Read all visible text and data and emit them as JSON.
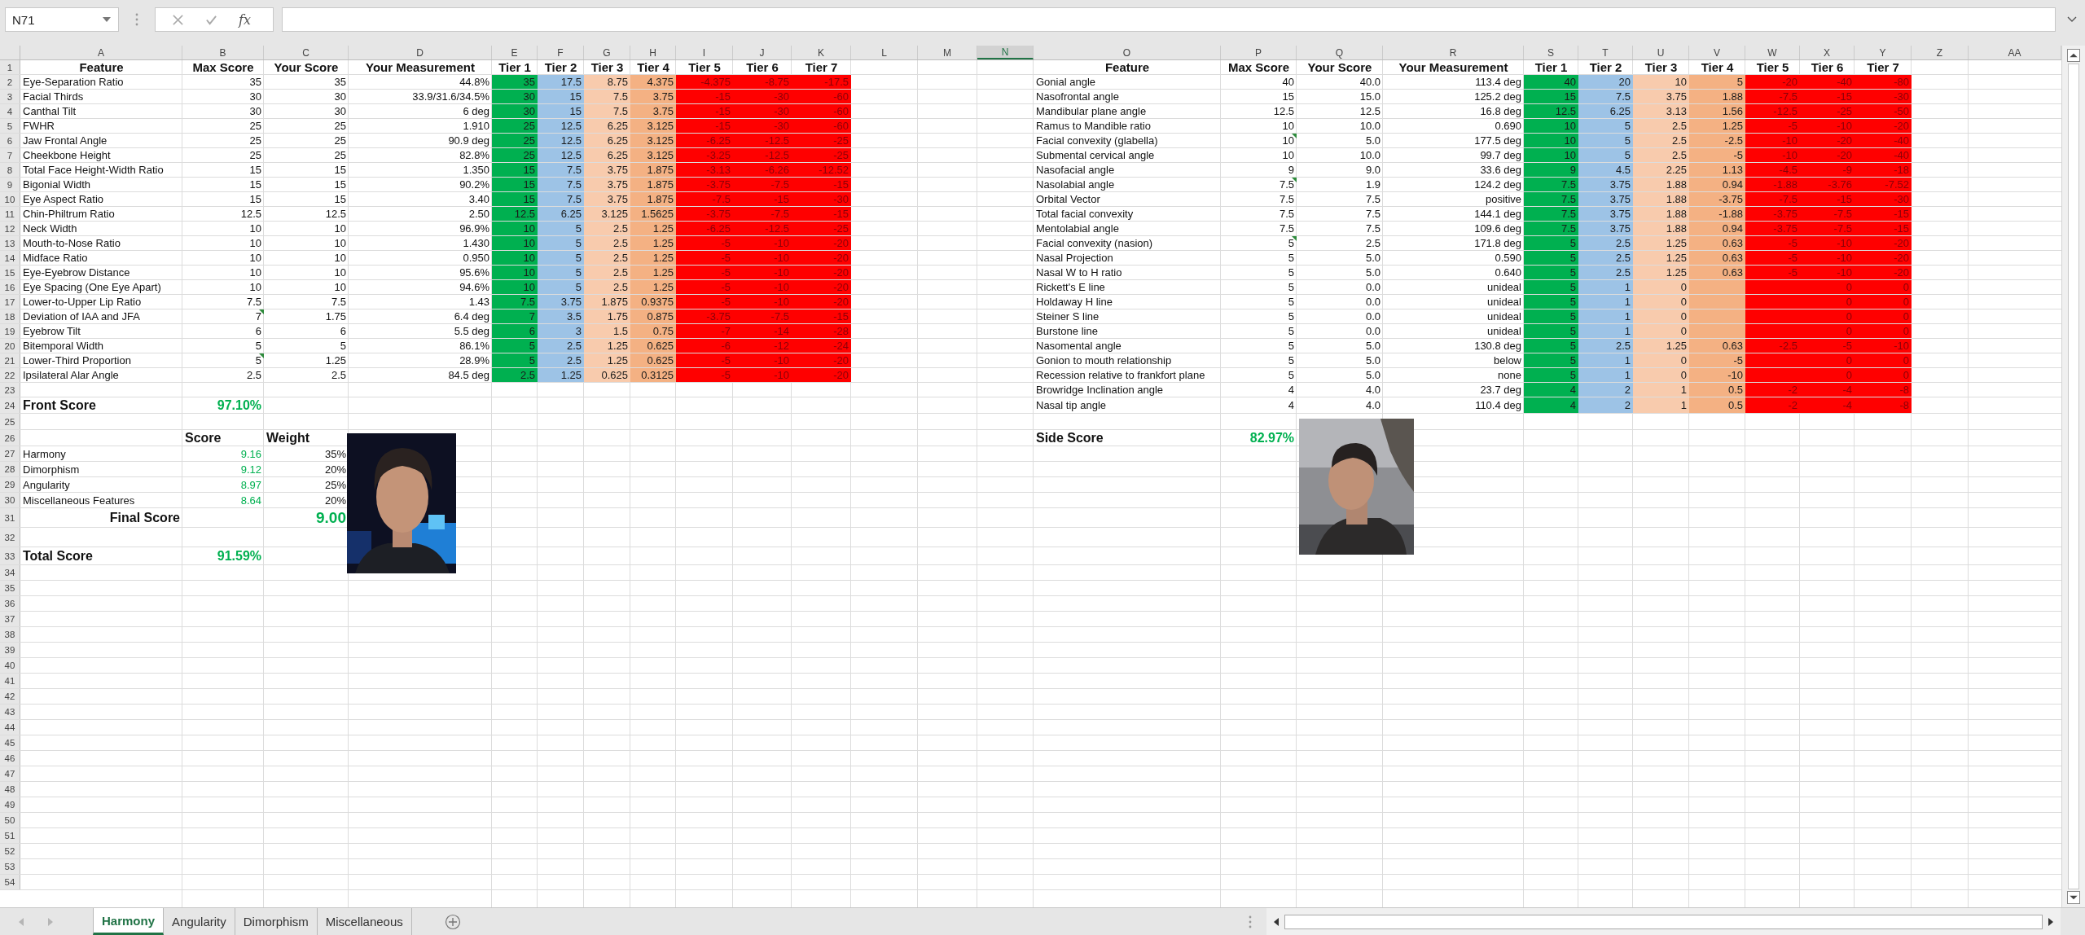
{
  "name_box": {
    "value": "N71"
  },
  "formula_bar": {
    "function_label": "fx"
  },
  "column_headers": [
    {
      "label": "A",
      "selected": false
    },
    {
      "label": "B",
      "selected": false
    },
    {
      "label": "C",
      "selected": false
    },
    {
      "label": "D",
      "selected": false
    },
    {
      "label": "E",
      "selected": false
    },
    {
      "label": "F",
      "selected": false
    },
    {
      "label": "G",
      "selected": false
    },
    {
      "label": "H",
      "selected": false
    },
    {
      "label": "I",
      "selected": false
    },
    {
      "label": "J",
      "selected": false
    },
    {
      "label": "K",
      "selected": false
    },
    {
      "label": "L",
      "selected": false
    },
    {
      "label": "M",
      "selected": false
    },
    {
      "label": "N",
      "selected": true
    },
    {
      "label": "O",
      "selected": false
    },
    {
      "label": "P",
      "selected": false
    },
    {
      "label": "Q",
      "selected": false
    },
    {
      "label": "R",
      "selected": false
    },
    {
      "label": "S",
      "selected": false
    },
    {
      "label": "T",
      "selected": false
    },
    {
      "label": "U",
      "selected": false
    },
    {
      "label": "V",
      "selected": false
    },
    {
      "label": "W",
      "selected": false
    },
    {
      "label": "X",
      "selected": false
    },
    {
      "label": "Y",
      "selected": false
    },
    {
      "label": "Z",
      "selected": false
    },
    {
      "label": "AA",
      "selected": false
    }
  ],
  "row_headers": [
    "1",
    "2",
    "3",
    "4",
    "5",
    "6",
    "7",
    "8",
    "9",
    "10",
    "11",
    "12",
    "13",
    "14",
    "15",
    "16",
    "17",
    "18",
    "19",
    "20",
    "21",
    "22",
    "23",
    "24",
    "25",
    "26",
    "27",
    "28",
    "29",
    "30",
    "31",
    "32",
    "33",
    "34",
    "35",
    "36",
    "37",
    "38",
    "39",
    "40",
    "41",
    "42",
    "43",
    "44",
    "45",
    "46",
    "47",
    "48",
    "49",
    "50",
    "51",
    "52",
    "53",
    "54"
  ],
  "front_table": {
    "columns": [
      "Feature",
      "Max Score",
      "Your Score",
      "Your Measurement"
    ],
    "tier_columns": [
      {
        "label": "Tier 1",
        "color": "#00b050"
      },
      {
        "label": "Tier 2",
        "color": "#9dc3e6"
      },
      {
        "label": "Tier 3",
        "color": "#f8cbad"
      },
      {
        "label": "Tier 4",
        "color": "#f4b183"
      },
      {
        "label": "Tier 5",
        "color": "#ff0000"
      },
      {
        "label": "Tier 6",
        "color": "#ff0000"
      },
      {
        "label": "Tier 7",
        "color": "#ff0000"
      }
    ],
    "rows": [
      {
        "feature": "Eye-Separation Ratio",
        "max_score": "35",
        "your_score": "35",
        "measurement": "44.8%",
        "tiers": {
          "tier_1": "35",
          "tier_2": "17.5",
          "tier_3": "8.75",
          "tier_4": "4.375",
          "tier_5": "-4.375",
          "tier_6": "-8.75",
          "tier_7": "-17.5"
        },
        "note": false
      },
      {
        "feature": "Facial Thirds",
        "max_score": "30",
        "your_score": "30",
        "measurement": "33.9/31.6/34.5%",
        "tiers": {
          "tier_1": "30",
          "tier_2": "15",
          "tier_3": "7.5",
          "tier_4": "3.75",
          "tier_5": "-15",
          "tier_6": "-30",
          "tier_7": "-60"
        },
        "note": false
      },
      {
        "feature": "Canthal Tilt",
        "max_score": "30",
        "your_score": "30",
        "measurement": "6 deg",
        "tiers": {
          "tier_1": "30",
          "tier_2": "15",
          "tier_3": "7.5",
          "tier_4": "3.75",
          "tier_5": "-15",
          "tier_6": "-30",
          "tier_7": "-60"
        },
        "note": false
      },
      {
        "feature": "FWHR",
        "max_score": "25",
        "your_score": "25",
        "measurement": "1.910",
        "tiers": {
          "tier_1": "25",
          "tier_2": "12.5",
          "tier_3": "6.25",
          "tier_4": "3.125",
          "tier_5": "-15",
          "tier_6": "-30",
          "tier_7": "-60"
        },
        "note": false
      },
      {
        "feature": "Jaw Frontal Angle",
        "max_score": "25",
        "your_score": "25",
        "measurement": "90.9 deg",
        "tiers": {
          "tier_1": "25",
          "tier_2": "12.5",
          "tier_3": "6.25",
          "tier_4": "3.125",
          "tier_5": "-6.25",
          "tier_6": "-12.5",
          "tier_7": "-25"
        },
        "note": false
      },
      {
        "feature": "Cheekbone Height",
        "max_score": "25",
        "your_score": "25",
        "measurement": "82.8%",
        "tiers": {
          "tier_1": "25",
          "tier_2": "12.5",
          "tier_3": "6.25",
          "tier_4": "3.125",
          "tier_5": "-3.25",
          "tier_6": "-12.5",
          "tier_7": "-25"
        },
        "note": false
      },
      {
        "feature": "Total Face Height-Width Ratio",
        "max_score": "15",
        "your_score": "15",
        "measurement": "1.350",
        "tiers": {
          "tier_1": "15",
          "tier_2": "7.5",
          "tier_3": "3.75",
          "tier_4": "1.875",
          "tier_5": "-3.13",
          "tier_6": "-6.26",
          "tier_7": "-12.52"
        },
        "note": false
      },
      {
        "feature": "Bigonial Width",
        "max_score": "15",
        "your_score": "15",
        "measurement": "90.2%",
        "tiers": {
          "tier_1": "15",
          "tier_2": "7.5",
          "tier_3": "3.75",
          "tier_4": "1.875",
          "tier_5": "-3.75",
          "tier_6": "-7.5",
          "tier_7": "-15"
        },
        "note": false
      },
      {
        "feature": "Eye Aspect Ratio",
        "max_score": "15",
        "your_score": "15",
        "measurement": "3.40",
        "tiers": {
          "tier_1": "15",
          "tier_2": "7.5",
          "tier_3": "3.75",
          "tier_4": "1.875",
          "tier_5": "-7.5",
          "tier_6": "-15",
          "tier_7": "-30"
        },
        "note": false
      },
      {
        "feature": "Chin-Philtrum Ratio",
        "max_score": "12.5",
        "your_score": "12.5",
        "measurement": "2.50",
        "tiers": {
          "tier_1": "12.5",
          "tier_2": "6.25",
          "tier_3": "3.125",
          "tier_4": "1.5625",
          "tier_5": "-3.75",
          "tier_6": "-7.5",
          "tier_7": "-15"
        },
        "note": false
      },
      {
        "feature": "Neck Width",
        "max_score": "10",
        "your_score": "10",
        "measurement": "96.9%",
        "tiers": {
          "tier_1": "10",
          "tier_2": "5",
          "tier_3": "2.5",
          "tier_4": "1.25",
          "tier_5": "-6.25",
          "tier_6": "-12.5",
          "tier_7": "-25"
        },
        "note": false
      },
      {
        "feature": "Mouth-to-Nose Ratio",
        "max_score": "10",
        "your_score": "10",
        "measurement": "1.430",
        "tiers": {
          "tier_1": "10",
          "tier_2": "5",
          "tier_3": "2.5",
          "tier_4": "1.25",
          "tier_5": "-5",
          "tier_6": "-10",
          "tier_7": "-20"
        },
        "note": false
      },
      {
        "feature": "Midface Ratio",
        "max_score": "10",
        "your_score": "10",
        "measurement": "0.950",
        "tiers": {
          "tier_1": "10",
          "tier_2": "5",
          "tier_3": "2.5",
          "tier_4": "1.25",
          "tier_5": "-5",
          "tier_6": "-10",
          "tier_7": "-20"
        },
        "note": false
      },
      {
        "feature": "Eye-Eyebrow Distance",
        "max_score": "10",
        "your_score": "10",
        "measurement": "95.6%",
        "tiers": {
          "tier_1": "10",
          "tier_2": "5",
          "tier_3": "2.5",
          "tier_4": "1.25",
          "tier_5": "-5",
          "tier_6": "-10",
          "tier_7": "-20"
        },
        "note": false
      },
      {
        "feature": "Eye Spacing (One Eye Apart)",
        "max_score": "10",
        "your_score": "10",
        "measurement": "94.6%",
        "tiers": {
          "tier_1": "10",
          "tier_2": "5",
          "tier_3": "2.5",
          "tier_4": "1.25",
          "tier_5": "-5",
          "tier_6": "-10",
          "tier_7": "-20"
        },
        "note": false
      },
      {
        "feature": "Lower-to-Upper Lip Ratio",
        "max_score": "7.5",
        "your_score": "7.5",
        "measurement": "1.43",
        "tiers": {
          "tier_1": "7.5",
          "tier_2": "3.75",
          "tier_3": "1.875",
          "tier_4": "0.9375",
          "tier_5": "-5",
          "tier_6": "-10",
          "tier_7": "-20"
        },
        "note": false
      },
      {
        "feature": "Deviation of IAA and JFA",
        "max_score": "7",
        "your_score": "1.75",
        "measurement": "6.4 deg",
        "tiers": {
          "tier_1": "7",
          "tier_2": "3.5",
          "tier_3": "1.75",
          "tier_4": "0.875",
          "tier_5": "-3.75",
          "tier_6": "-7.5",
          "tier_7": "-15"
        },
        "note": true
      },
      {
        "feature": "Eyebrow Tilt",
        "max_score": "6",
        "your_score": "6",
        "measurement": "5.5 deg",
        "tiers": {
          "tier_1": "6",
          "tier_2": "3",
          "tier_3": "1.5",
          "tier_4": "0.75",
          "tier_5": "-7",
          "tier_6": "-14",
          "tier_7": "-28"
        },
        "note": false
      },
      {
        "feature": "Bitemporal Width",
        "max_score": "5",
        "your_score": "5",
        "measurement": "86.1%",
        "tiers": {
          "tier_1": "5",
          "tier_2": "2.5",
          "tier_3": "1.25",
          "tier_4": "0.625",
          "tier_5": "-6",
          "tier_6": "-12",
          "tier_7": "-24"
        },
        "note": false
      },
      {
        "feature": "Lower-Third Proportion",
        "max_score": "5",
        "your_score": "1.25",
        "measurement": "28.9%",
        "tiers": {
          "tier_1": "5",
          "tier_2": "2.5",
          "tier_3": "1.25",
          "tier_4": "0.625",
          "tier_5": "-5",
          "tier_6": "-10",
          "tier_7": "-20"
        },
        "note": true
      },
      {
        "feature": "Ipsilateral Alar Angle",
        "max_score": "2.5",
        "your_score": "2.5",
        "measurement": "84.5 deg",
        "tiers": {
          "tier_1": "2.5",
          "tier_2": "1.25",
          "tier_3": "0.625",
          "tier_4": "0.3125",
          "tier_5": "-5",
          "tier_6": "-10",
          "tier_7": "-20"
        },
        "note": false
      }
    ]
  },
  "front_summary": {
    "front_score": {
      "label": "Front Score",
      "value": "97.10%"
    },
    "breakdown_columns": [
      "Score",
      "Weight"
    ],
    "breakdown": [
      {
        "label": "Harmony",
        "score": "9.16",
        "weight": "35%"
      },
      {
        "label": "Dimorphism",
        "score": "9.12",
        "weight": "20%"
      },
      {
        "label": "Angularity",
        "score": "8.97",
        "weight": "25%"
      },
      {
        "label": "Miscellaneous Features",
        "score": "8.64",
        "weight": "20%"
      }
    ],
    "final_score": {
      "label": "Final Score",
      "value": "9.00"
    },
    "total_score": {
      "label": "Total Score",
      "value": "91.59%"
    }
  },
  "side_table": {
    "columns": [
      "Feature",
      "Max Score",
      "Your Score",
      "Your Measurement"
    ],
    "tier_columns": [
      {
        "label": "Tier 1",
        "color": "#00b050"
      },
      {
        "label": "Tier 2",
        "color": "#9dc3e6"
      },
      {
        "label": "Tier 3",
        "color": "#f8cbad"
      },
      {
        "label": "Tier 4",
        "color": "#f4b183"
      },
      {
        "label": "Tier 5",
        "color": "#ff0000"
      },
      {
        "label": "Tier 6",
        "color": "#ff0000"
      },
      {
        "label": "Tier 7",
        "color": "#ff0000"
      }
    ],
    "rows": [
      {
        "feature": "Gonial angle",
        "max_score": "40",
        "your_score": "40.0",
        "measurement": "113.4 deg",
        "tiers": {
          "tier_1": "40",
          "tier_2": "20",
          "tier_3": "10",
          "tier_4": "5",
          "tier_5": "-20",
          "tier_6": "-40",
          "tier_7": "-80"
        },
        "note": false
      },
      {
        "feature": "Nasofrontal angle",
        "max_score": "15",
        "your_score": "15.0",
        "measurement": "125.2 deg",
        "tiers": {
          "tier_1": "15",
          "tier_2": "7.5",
          "tier_3": "3.75",
          "tier_4": "1.88",
          "tier_5": "-7.5",
          "tier_6": "-15",
          "tier_7": "-30"
        },
        "note": false
      },
      {
        "feature": "Mandibular plane angle",
        "max_score": "12.5",
        "your_score": "12.5",
        "measurement": "16.8 deg",
        "tiers": {
          "tier_1": "12.5",
          "tier_2": "6.25",
          "tier_3": "3.13",
          "tier_4": "1.56",
          "tier_5": "-12.5",
          "tier_6": "-25",
          "tier_7": "-50"
        },
        "note": false
      },
      {
        "feature": "Ramus to Mandible ratio",
        "max_score": "10",
        "your_score": "10.0",
        "measurement": "0.690",
        "tiers": {
          "tier_1": "10",
          "tier_2": "5",
          "tier_3": "2.5",
          "tier_4": "1.25",
          "tier_5": "-5",
          "tier_6": "-10",
          "tier_7": "-20"
        },
        "note": false
      },
      {
        "feature": "Facial convexity (glabella)",
        "max_score": "10",
        "your_score": "5.0",
        "measurement": "177.5 deg",
        "tiers": {
          "tier_1": "10",
          "tier_2": "5",
          "tier_3": "2.5",
          "tier_4": "-2.5",
          "tier_5": "-10",
          "tier_6": "-20",
          "tier_7": "-40"
        },
        "note": true
      },
      {
        "feature": "Submental cervical angle",
        "max_score": "10",
        "your_score": "10.0",
        "measurement": "99.7 deg",
        "tiers": {
          "tier_1": "10",
          "tier_2": "5",
          "tier_3": "2.5",
          "tier_4": "-5",
          "tier_5": "-10",
          "tier_6": "-20",
          "tier_7": "-40"
        },
        "note": false
      },
      {
        "feature": "Nasofacial angle",
        "max_score": "9",
        "your_score": "9.0",
        "measurement": "33.6 deg",
        "tiers": {
          "tier_1": "9",
          "tier_2": "4.5",
          "tier_3": "2.25",
          "tier_4": "1.13",
          "tier_5": "-4.5",
          "tier_6": "-9",
          "tier_7": "-18"
        },
        "note": false
      },
      {
        "feature": "Nasolabial angle",
        "max_score": "7.5",
        "your_score": "1.9",
        "measurement": "124.2 deg",
        "tiers": {
          "tier_1": "7.5",
          "tier_2": "3.75",
          "tier_3": "1.88",
          "tier_4": "0.94",
          "tier_5": "-1.88",
          "tier_6": "-3.76",
          "tier_7": "-7.52"
        },
        "note": true
      },
      {
        "feature": "Orbital Vector",
        "max_score": "7.5",
        "your_score": "7.5",
        "measurement": "positive",
        "tiers": {
          "tier_1": "7.5",
          "tier_2": "3.75",
          "tier_3": "1.88",
          "tier_4": "-3.75",
          "tier_5": "-7.5",
          "tier_6": "-15",
          "tier_7": "-30"
        },
        "note": false
      },
      {
        "feature": "Total facial convexity",
        "max_score": "7.5",
        "your_score": "7.5",
        "measurement": "144.1 deg",
        "tiers": {
          "tier_1": "7.5",
          "tier_2": "3.75",
          "tier_3": "1.88",
          "tier_4": "-1.88",
          "tier_5": "-3.75",
          "tier_6": "-7.5",
          "tier_7": "-15"
        },
        "note": false
      },
      {
        "feature": "Mentolabial angle",
        "max_score": "7.5",
        "your_score": "7.5",
        "measurement": "109.6 deg",
        "tiers": {
          "tier_1": "7.5",
          "tier_2": "3.75",
          "tier_3": "1.88",
          "tier_4": "0.94",
          "tier_5": "-3.75",
          "tier_6": "-7.5",
          "tier_7": "-15"
        },
        "note": false
      },
      {
        "feature": "Facial convexity (nasion)",
        "max_score": "5",
        "your_score": "2.5",
        "measurement": "171.8 deg",
        "tiers": {
          "tier_1": "5",
          "tier_2": "2.5",
          "tier_3": "1.25",
          "tier_4": "0.63",
          "tier_5": "-5",
          "tier_6": "-10",
          "tier_7": "-20"
        },
        "note": true
      },
      {
        "feature": "Nasal Projection",
        "max_score": "5",
        "your_score": "5.0",
        "measurement": "0.590",
        "tiers": {
          "tier_1": "5",
          "tier_2": "2.5",
          "tier_3": "1.25",
          "tier_4": "0.63",
          "tier_5": "-5",
          "tier_6": "-10",
          "tier_7": "-20"
        },
        "note": false
      },
      {
        "feature": "Nasal W to H ratio",
        "max_score": "5",
        "your_score": "5.0",
        "measurement": "0.640",
        "tiers": {
          "tier_1": "5",
          "tier_2": "2.5",
          "tier_3": "1.25",
          "tier_4": "0.63",
          "tier_5": "-5",
          "tier_6": "-10",
          "tier_7": "-20"
        },
        "note": false
      },
      {
        "feature": "Rickett's E line",
        "max_score": "5",
        "your_score": "0.0",
        "measurement": "unideal",
        "tiers": {
          "tier_1": "5",
          "tier_2": "1",
          "tier_3": "0",
          "tier_6": "0",
          "tier_7": "0"
        },
        "note": false
      },
      {
        "feature": "Holdaway H line",
        "max_score": "5",
        "your_score": "0.0",
        "measurement": "unideal",
        "tiers": {
          "tier_1": "5",
          "tier_2": "1",
          "tier_3": "0",
          "tier_6": "0",
          "tier_7": "0"
        },
        "note": false
      },
      {
        "feature": "Steiner S line",
        "max_score": "5",
        "your_score": "0.0",
        "measurement": "unideal",
        "tiers": {
          "tier_1": "5",
          "tier_2": "1",
          "tier_3": "0",
          "tier_6": "0",
          "tier_7": "0"
        },
        "note": false
      },
      {
        "feature": "Burstone line",
        "max_score": "5",
        "your_score": "0.0",
        "measurement": "unideal",
        "tiers": {
          "tier_1": "5",
          "tier_2": "1",
          "tier_3": "0",
          "tier_6": "0",
          "tier_7": "0"
        },
        "note": false
      },
      {
        "feature": "Nasomental angle",
        "max_score": "5",
        "your_score": "5.0",
        "measurement": "130.8 deg",
        "tiers": {
          "tier_1": "5",
          "tier_2": "2.5",
          "tier_3": "1.25",
          "tier_4": "0.63",
          "tier_5": "-2.5",
          "tier_6": "-5",
          "tier_7": "-10"
        },
        "note": false
      },
      {
        "feature": "Gonion to mouth relationship",
        "max_score": "5",
        "your_score": "5.0",
        "measurement": "below",
        "tiers": {
          "tier_1": "5",
          "tier_2": "1",
          "tier_3": "0",
          "tier_4": "-5",
          "tier_6": "0",
          "tier_7": "0"
        },
        "note": false
      },
      {
        "feature": "Recession relative to frankfort plane",
        "max_score": "5",
        "your_score": "5.0",
        "measurement": "none",
        "tiers": {
          "tier_1": "5",
          "tier_2": "1",
          "tier_3": "0",
          "tier_4": "-10",
          "tier_6": "0",
          "tier_7": "0"
        },
        "note": false
      },
      {
        "feature": "Browridge Inclination angle",
        "max_score": "4",
        "your_score": "4.0",
        "measurement": "23.7 deg",
        "tiers": {
          "tier_1": "4",
          "tier_2": "2",
          "tier_3": "1",
          "tier_4": "0.5",
          "tier_5": "-2",
          "tier_6": "-4",
          "tier_7": "-8"
        },
        "note": false
      },
      {
        "feature": "Nasal tip angle",
        "max_score": "4",
        "your_score": "4.0",
        "measurement": "110.4 deg",
        "tiers": {
          "tier_1": "4",
          "tier_2": "2",
          "tier_3": "1",
          "tier_4": "0.5",
          "tier_5": "-2",
          "tier_6": "-4",
          "tier_7": "-8"
        },
        "note": false
      }
    ]
  },
  "side_summary": {
    "side_score": {
      "label": "Side Score",
      "value": "82.97%"
    }
  },
  "sheet_tabs": [
    {
      "label": "Harmony",
      "selected": true
    },
    {
      "label": "Angularity",
      "selected": false
    },
    {
      "label": "Dimorphism",
      "selected": false
    },
    {
      "label": "Miscellaneous",
      "selected": false
    }
  ]
}
